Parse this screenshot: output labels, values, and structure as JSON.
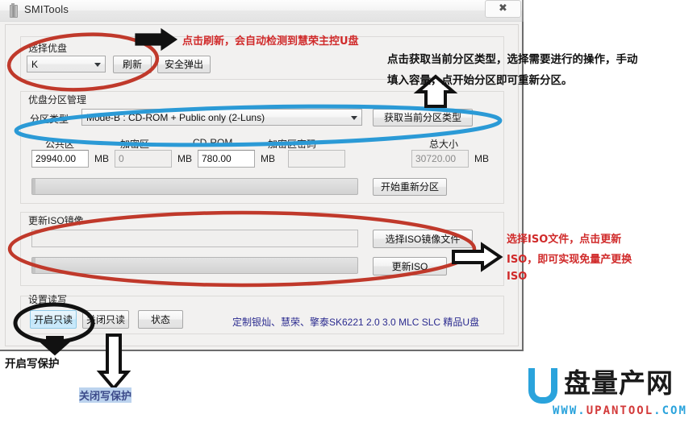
{
  "window": {
    "title": "SMITools",
    "close_label": "✖",
    "icon": "usb-drive-icon"
  },
  "select_disk_group": {
    "label": "选择优盘",
    "combo_value": "K",
    "refresh_button": "刷新",
    "safe_eject_button": "安全弹出"
  },
  "partition_group": {
    "label": "优盘分区管理",
    "type_label": "分区类型",
    "type_value": "Mode-B : CD-ROM + Public only        (2-Luns)",
    "get_type_button": "获取当前分区类型",
    "columns": [
      {
        "label": "公共区",
        "value": "29940.00",
        "unit": "MB",
        "disabled": false
      },
      {
        "label": "加密区",
        "value": "0",
        "unit": "MB",
        "disabled": true
      },
      {
        "label": "CD-ROM",
        "value": "780.00",
        "unit": "MB",
        "disabled": false
      },
      {
        "label": "加密区密码",
        "value": "",
        "unit": "",
        "disabled": true
      },
      {
        "label": "总大小",
        "value": "30720.00",
        "unit": "MB",
        "disabled": true
      }
    ],
    "repartition_button": "开始重新分区",
    "progress_value": 0
  },
  "iso_group": {
    "label": "更新ISO镜像",
    "path_value": "",
    "select_iso_button": "选择ISO镜像文件",
    "update_iso_button": "更新ISO",
    "progress_value": 0
  },
  "readwrite_group": {
    "label": "设置读写",
    "enable_readonly_button": "开启只读",
    "disable_readonly_button": "关闭只读",
    "status_button": "状态",
    "status_text": "定制银灿、慧荣、擎泰SK6221 2.0 3.0 MLC SLC 精品U盘"
  },
  "annotations": {
    "top_red": "点击刷新，会自动检测到慧荣主控U盘",
    "right_black_line1": "点击获取当前分区类型，选择需要进行的操作，手动",
    "right_black_line2": "填入容量，点开始分区即可重新分区。",
    "iso_red_line1": "选择ISO文件，点击更新",
    "iso_red_line2": "ISO，即可实现免量产更换",
    "iso_red_line3": "ISO",
    "enable_wp": "开启写保护",
    "disable_wp": "关闭写保护"
  },
  "watermark": {
    "logo_u": "U",
    "logo_cn": "盘量产网",
    "url_www": "WWW.",
    "url_name": "UPANTOOL",
    "url_com": ".COM"
  },
  "colors": {
    "red_annotation": "#d02a2a",
    "blue_ellipse": "#2b9ad6",
    "status_blue": "#2b2b8f",
    "brand_blue": "#2aa3dc"
  }
}
